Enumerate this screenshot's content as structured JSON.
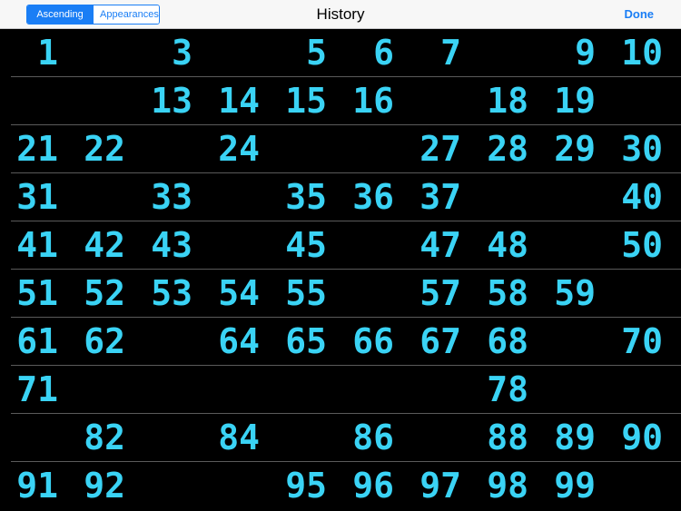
{
  "navbar": {
    "segments": [
      {
        "label": "Ascending",
        "selected": true
      },
      {
        "label": "Appearances",
        "selected": false
      }
    ],
    "title": "History",
    "done_label": "Done"
  },
  "colors": {
    "accent": "#1a7ef5",
    "number": "#3ad3f5",
    "background": "#000000"
  },
  "rows": [
    [
      "1",
      "",
      "3",
      "",
      "5",
      "6",
      "7",
      "",
      "9",
      "10"
    ],
    [
      "",
      "",
      "13",
      "14",
      "15",
      "16",
      "",
      "18",
      "19",
      ""
    ],
    [
      "21",
      "22",
      "",
      "24",
      "",
      "",
      "27",
      "28",
      "29",
      "30"
    ],
    [
      "31",
      "",
      "33",
      "",
      "35",
      "36",
      "37",
      "",
      "",
      "40"
    ],
    [
      "41",
      "42",
      "43",
      "",
      "45",
      "",
      "47",
      "48",
      "",
      "50"
    ],
    [
      "51",
      "52",
      "53",
      "54",
      "55",
      "",
      "57",
      "58",
      "59",
      ""
    ],
    [
      "61",
      "62",
      "",
      "64",
      "65",
      "66",
      "67",
      "68",
      "",
      "70"
    ],
    [
      "71",
      "",
      "",
      "",
      "",
      "",
      "",
      "78",
      "",
      ""
    ],
    [
      "",
      "82",
      "",
      "84",
      "",
      "86",
      "",
      "88",
      "89",
      "90"
    ],
    [
      "91",
      "92",
      "",
      "",
      "95",
      "96",
      "97",
      "98",
      "99",
      ""
    ]
  ]
}
